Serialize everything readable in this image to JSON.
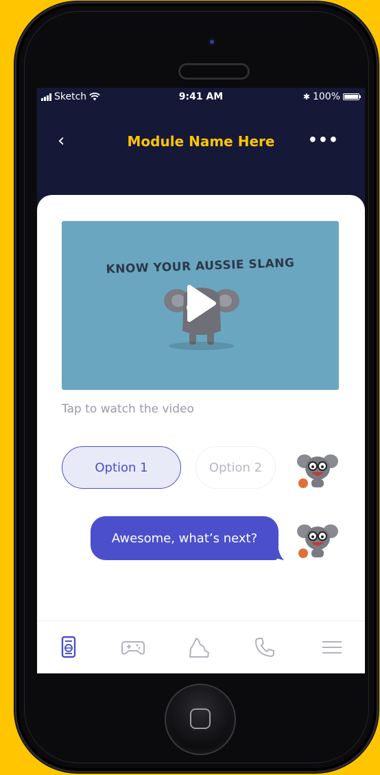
{
  "status_bar": {
    "carrier": "Sketch",
    "time": "9:41 AM",
    "bluetooth": "✱",
    "battery_percent": "100%"
  },
  "nav": {
    "back_glyph": "‹",
    "title": "Module Name Here",
    "more_glyph": "•••"
  },
  "video": {
    "title": "KNOW YOUR AUSSIE SLANG",
    "caption": "Tap to watch the video"
  },
  "options": [
    {
      "label": "Option 1",
      "selected": true
    },
    {
      "label": "Option 2",
      "selected": false
    }
  ],
  "reply": {
    "text": "Awesome, what’s next?"
  },
  "tabs": [
    {
      "icon": "passport-icon",
      "active": true
    },
    {
      "icon": "gamepad-icon",
      "active": false
    },
    {
      "icon": "australia-map-icon",
      "active": false
    },
    {
      "icon": "phone-icon",
      "active": false
    },
    {
      "icon": "menu-icon",
      "active": false
    }
  ],
  "colors": {
    "brand_yellow": "#FFC600",
    "header_navy": "#161838",
    "accent_purple": "#4B4FCC",
    "video_blue": "#6AA6C0"
  }
}
